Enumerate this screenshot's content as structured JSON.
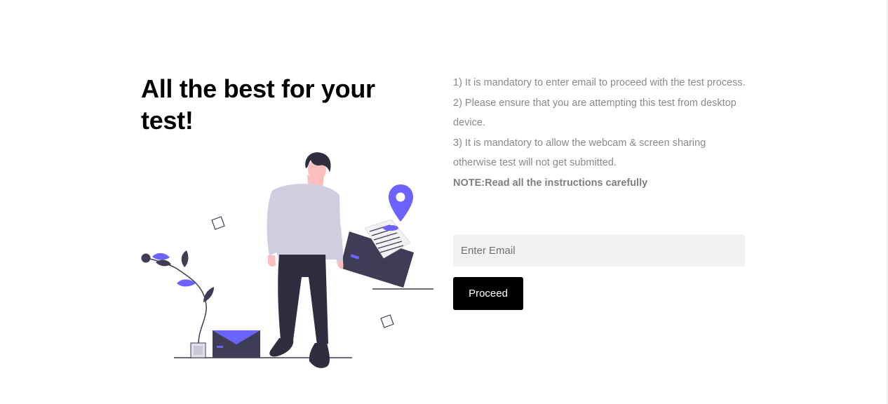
{
  "heading": "All the best for your test!",
  "instructions": [
    "1) It is mandatory to enter email to proceed with the test process.",
    "2) Please ensure that you are attempting this test from desktop device.",
    "3) It is mandatory to allow the webcam & screen sharing otherwise test will not get submitted."
  ],
  "note": "NOTE:Read all the instructions carefully",
  "email_input": {
    "placeholder": "Enter Email",
    "value": ""
  },
  "proceed_label": "Proceed",
  "colors": {
    "accent": "#6c63ff",
    "button_bg": "#000000",
    "input_bg": "#f2f2f2",
    "instruction_text": "#8a8a8a"
  },
  "illustration": {
    "icons": [
      "person-figure",
      "open-envelope-icon",
      "location-pin-icon",
      "closed-envelope-icon",
      "plant-icon"
    ]
  }
}
